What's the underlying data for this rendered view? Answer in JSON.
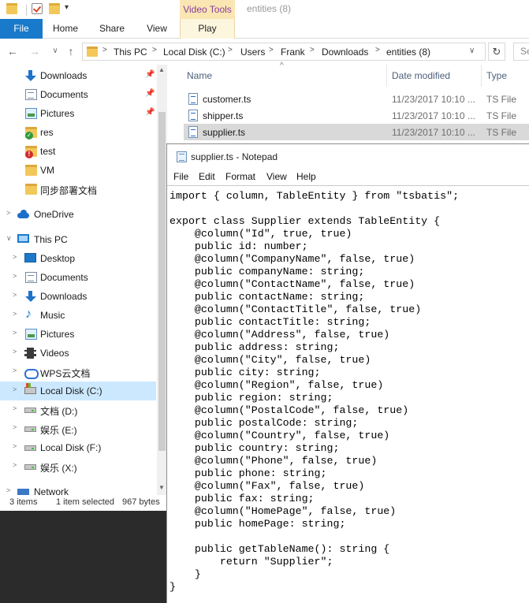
{
  "quick_access_toolbar": {
    "customize_glyph": "▾"
  },
  "contextual_tab_group": "Video Tools",
  "window_title": "entities (8)",
  "ribbon_tabs": {
    "file": "File",
    "home": "Home",
    "share": "Share",
    "view": "View",
    "play": "Play"
  },
  "nav_glyphs": {
    "back": "←",
    "forward": "→",
    "recent": "∨",
    "up": "↑",
    "separator": ">",
    "dropdown": "∨",
    "refresh": "↻"
  },
  "address_bar": {
    "crumbs": [
      "This PC",
      "Local Disk (C:)",
      "Users",
      "Frank",
      "Downloads",
      "entities (8)"
    ]
  },
  "search_placeholder": "Se",
  "nav_pane": {
    "quick_access": [
      {
        "label": "Downloads",
        "icon": "download-icon",
        "pinned": true
      },
      {
        "label": "Documents",
        "icon": "documents-icon",
        "pinned": true
      },
      {
        "label": "Pictures",
        "icon": "pictures-icon",
        "pinned": true
      },
      {
        "label": "res",
        "icon": "folder-sync-ok-icon"
      },
      {
        "label": "test",
        "icon": "folder-sync-error-icon"
      },
      {
        "label": "VM",
        "icon": "folder-icon"
      },
      {
        "label": "同步部署文档",
        "icon": "folder-icon"
      }
    ],
    "onedrive": "OneDrive",
    "this_pc": "This PC",
    "this_pc_items": [
      {
        "label": "Desktop",
        "icon": "desktop-icon"
      },
      {
        "label": "Documents",
        "icon": "documents-icon"
      },
      {
        "label": "Downloads",
        "icon": "download-icon"
      },
      {
        "label": "Music",
        "icon": "music-icon"
      },
      {
        "label": "Pictures",
        "icon": "pictures-icon"
      },
      {
        "label": "Videos",
        "icon": "videos-icon"
      },
      {
        "label": "WPS云文档",
        "icon": "wps-cloud-icon"
      },
      {
        "label": "Local Disk (C:)",
        "icon": "system-drive-icon",
        "selected": true
      },
      {
        "label": "文档 (D:)",
        "icon": "drive-icon"
      },
      {
        "label": "娱乐 (E:)",
        "icon": "drive-icon"
      },
      {
        "label": "Local Disk (F:)",
        "icon": "drive-icon"
      },
      {
        "label": "娱乐 (X:)",
        "icon": "drive-icon"
      }
    ],
    "network": "Network",
    "pin_glyph": "📌"
  },
  "status_bar": {
    "items": "3 items",
    "selected": "1 item selected",
    "size": "967 bytes"
  },
  "file_list": {
    "columns": {
      "name": "Name",
      "date": "Date modified",
      "type": "Type"
    },
    "sort_glyph": "^",
    "files": [
      {
        "name": "customer.ts",
        "date": "11/23/2017 10:10 ...",
        "type": "TS File"
      },
      {
        "name": "shipper.ts",
        "date": "11/23/2017 10:10 ...",
        "type": "TS File"
      },
      {
        "name": "supplier.ts",
        "date": "11/23/2017 10:10 ...",
        "type": "TS File",
        "selected": true
      }
    ]
  },
  "notepad": {
    "title": "supplier.ts - Notepad",
    "menu": {
      "file": "File",
      "edit": "Edit",
      "format": "Format",
      "view": "View",
      "help": "Help"
    },
    "content": "import { column, TableEntity } from \"tsbatis\";\n\nexport class Supplier extends TableEntity {\n    @column(\"Id\", true, true)\n    public id: number;\n    @column(\"CompanyName\", false, true)\n    public companyName: string;\n    @column(\"ContactName\", false, true)\n    public contactName: string;\n    @column(\"ContactTitle\", false, true)\n    public contactTitle: string;\n    @column(\"Address\", false, true)\n    public address: string;\n    @column(\"City\", false, true)\n    public city: string;\n    @column(\"Region\", false, true)\n    public region: string;\n    @column(\"PostalCode\", false, true)\n    public postalCode: string;\n    @column(\"Country\", false, true)\n    public country: string;\n    @column(\"Phone\", false, true)\n    public phone: string;\n    @column(\"Fax\", false, true)\n    public fax: string;\n    @column(\"HomePage\", false, true)\n    public homePage: string;\n\n    public getTableName(): string {\n        return \"Supplier\";\n    }\n}"
  },
  "colors": {
    "file_tab": "#1979ca",
    "selection": "#cce8ff",
    "video_tools": "#8a3c9c"
  }
}
